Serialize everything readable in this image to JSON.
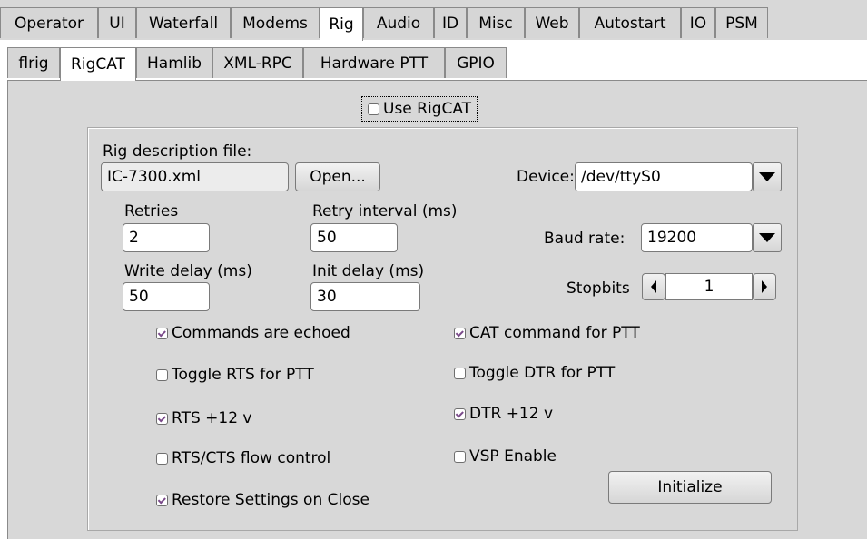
{
  "top_tabs": [
    "Operator",
    "UI",
    "Waterfall",
    "Modems",
    "Rig",
    "Audio",
    "ID",
    "Misc",
    "Web",
    "Autostart",
    "IO",
    "PSM"
  ],
  "active_top_tab": "Rig",
  "sub_tabs": [
    "flrig",
    "RigCAT",
    "Hamlib",
    "XML-RPC",
    "Hardware PTT",
    "GPIO"
  ],
  "active_sub_tab": "RigCAT",
  "use_rigcat": {
    "label": "Use RigCAT",
    "checked": false
  },
  "rig_desc": {
    "label": "Rig description file:",
    "value": "IC-7300.xml",
    "open_button": "Open..."
  },
  "device": {
    "label": "Device:",
    "value": "/dev/ttyS0"
  },
  "retries": {
    "label": "Retries",
    "value": "2"
  },
  "retry_interval": {
    "label": "Retry interval (ms)",
    "value": "50"
  },
  "baud_rate": {
    "label": "Baud rate:",
    "value": "19200"
  },
  "write_delay": {
    "label": "Write delay (ms)",
    "value": "50"
  },
  "init_delay": {
    "label": "Init delay (ms)",
    "value": "30"
  },
  "stopbits": {
    "label": "Stopbits",
    "value": "1"
  },
  "checkboxes": [
    {
      "label": "Commands are echoed",
      "checked": true
    },
    {
      "label": "CAT command for PTT",
      "checked": true
    },
    {
      "label": "Toggle RTS for PTT",
      "checked": false
    },
    {
      "label": "Toggle DTR for PTT",
      "checked": false
    },
    {
      "label": "RTS +12 v",
      "checked": true
    },
    {
      "label": "DTR +12 v",
      "checked": true
    },
    {
      "label": "RTS/CTS flow control",
      "checked": false
    },
    {
      "label": "VSP Enable",
      "checked": false
    },
    {
      "label": "Restore Settings on Close",
      "checked": true
    }
  ],
  "initialize_button": "Initialize"
}
